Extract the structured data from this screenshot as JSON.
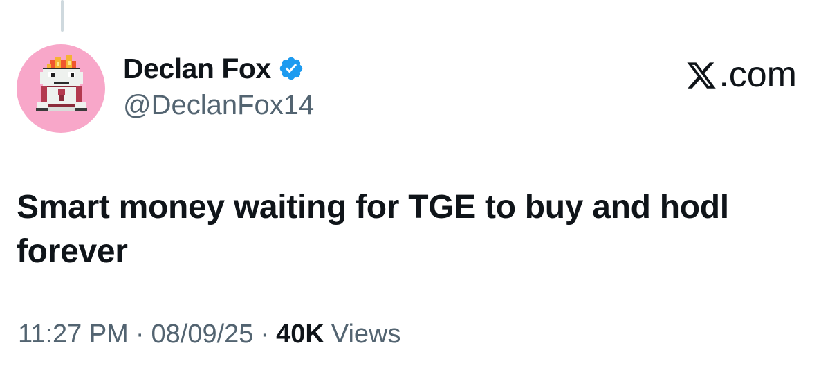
{
  "tweet": {
    "author": {
      "display_name": "Declan Fox",
      "handle": "@DeclanFox14",
      "verified": true,
      "avatar_bg": "#f8a7c9"
    },
    "site": {
      "logo_icon": "x-logo-icon",
      "label": ".com"
    },
    "text": "Smart money waiting for TGE to buy and hodl forever",
    "meta": {
      "time": "11:27 PM",
      "separator": "·",
      "date": "08/09/25",
      "views_count": "40K",
      "views_label": "Views"
    }
  },
  "colors": {
    "text_primary": "#0f1419",
    "text_secondary": "#536471",
    "verified_blue": "#1d9bf0",
    "thread_line": "#cfd9de"
  }
}
